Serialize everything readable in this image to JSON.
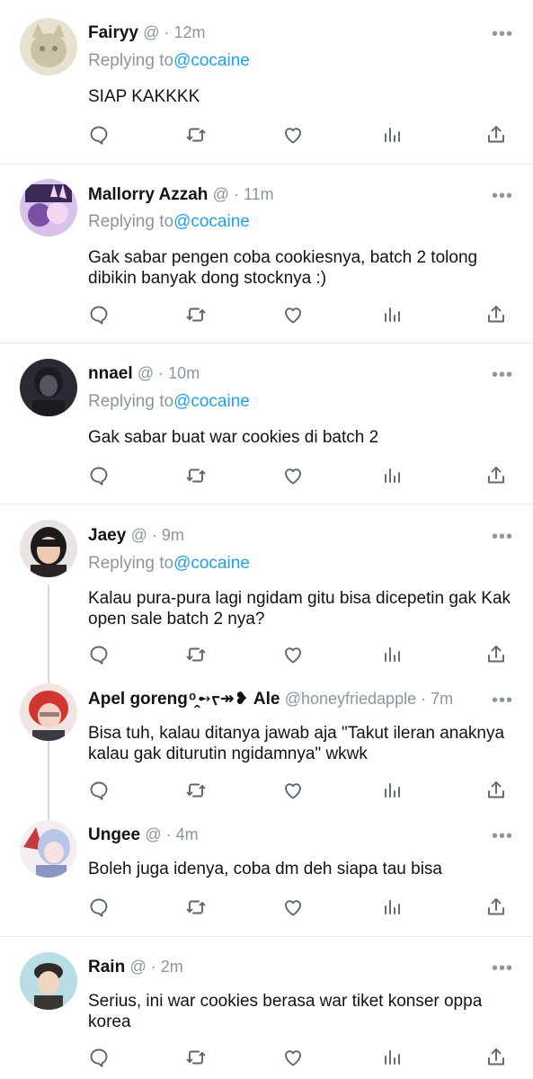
{
  "more_glyph": "•••",
  "replying_prefix": "Replying to",
  "tweets": [
    {
      "name": "Fairyy",
      "meta": "@ · 12m",
      "reply_handle": "@cocaine",
      "text": "SIAP KAKKKK",
      "avatar_colors": [
        "#e7e2cf",
        "#c9c2a4",
        "#8a8670"
      ]
    },
    {
      "name": "Mallorry Azzah",
      "meta": "@ · 11m",
      "reply_handle": "@cocaine",
      "text": "Gak sabar pengen coba cookiesnya, batch 2 tolong dibikin banyak dong stocknya :)",
      "avatar_colors": [
        "#d8c2ec",
        "#7a4fa6",
        "#f3d6ef"
      ]
    },
    {
      "name": "nnael",
      "meta": "@ · 10m",
      "reply_handle": "@cocaine",
      "text": "Gak sabar buat war cookies di batch 2",
      "avatar_colors": [
        "#2a2a33",
        "#55535f",
        "#1b1b22"
      ]
    },
    {
      "name": "Jaey",
      "meta": "@ · 9m",
      "reply_handle": "@cocaine",
      "text": "Kalau pura-pura lagi ngidam gitu bisa dicepetin gak Kak open sale batch 2 nya?",
      "avatar_colors": [
        "#e9e4e2",
        "#1f1a1a",
        "#f0c9b5"
      ]
    },
    {
      "name": "Apel goreng ͦ ̭➻ᡕ↠❥ Ale",
      "meta": "@honeyfriedapple · 7m",
      "text": "Bisa tuh, kalau ditanya jawab aja \"Takut ileran anaknya kalau gak diturutin ngidamnya\" wkwk",
      "avatar_colors": [
        "#f3e6e2",
        "#d0352e",
        "#f6d3c4"
      ]
    },
    {
      "name": "Ungee",
      "meta": "@ · 4m",
      "text": "Boleh juga idenya, coba dm deh siapa tau bisa",
      "avatar_colors": [
        "#f4eef2",
        "#c63a3a",
        "#b9c6e6"
      ]
    },
    {
      "name": "Rain",
      "meta": "@ · 2m",
      "text": "Serius, ini war cookies berasa war tiket konser oppa korea",
      "avatar_colors": [
        "#b8dde4",
        "#2f2a28",
        "#f0d6c1"
      ]
    }
  ]
}
